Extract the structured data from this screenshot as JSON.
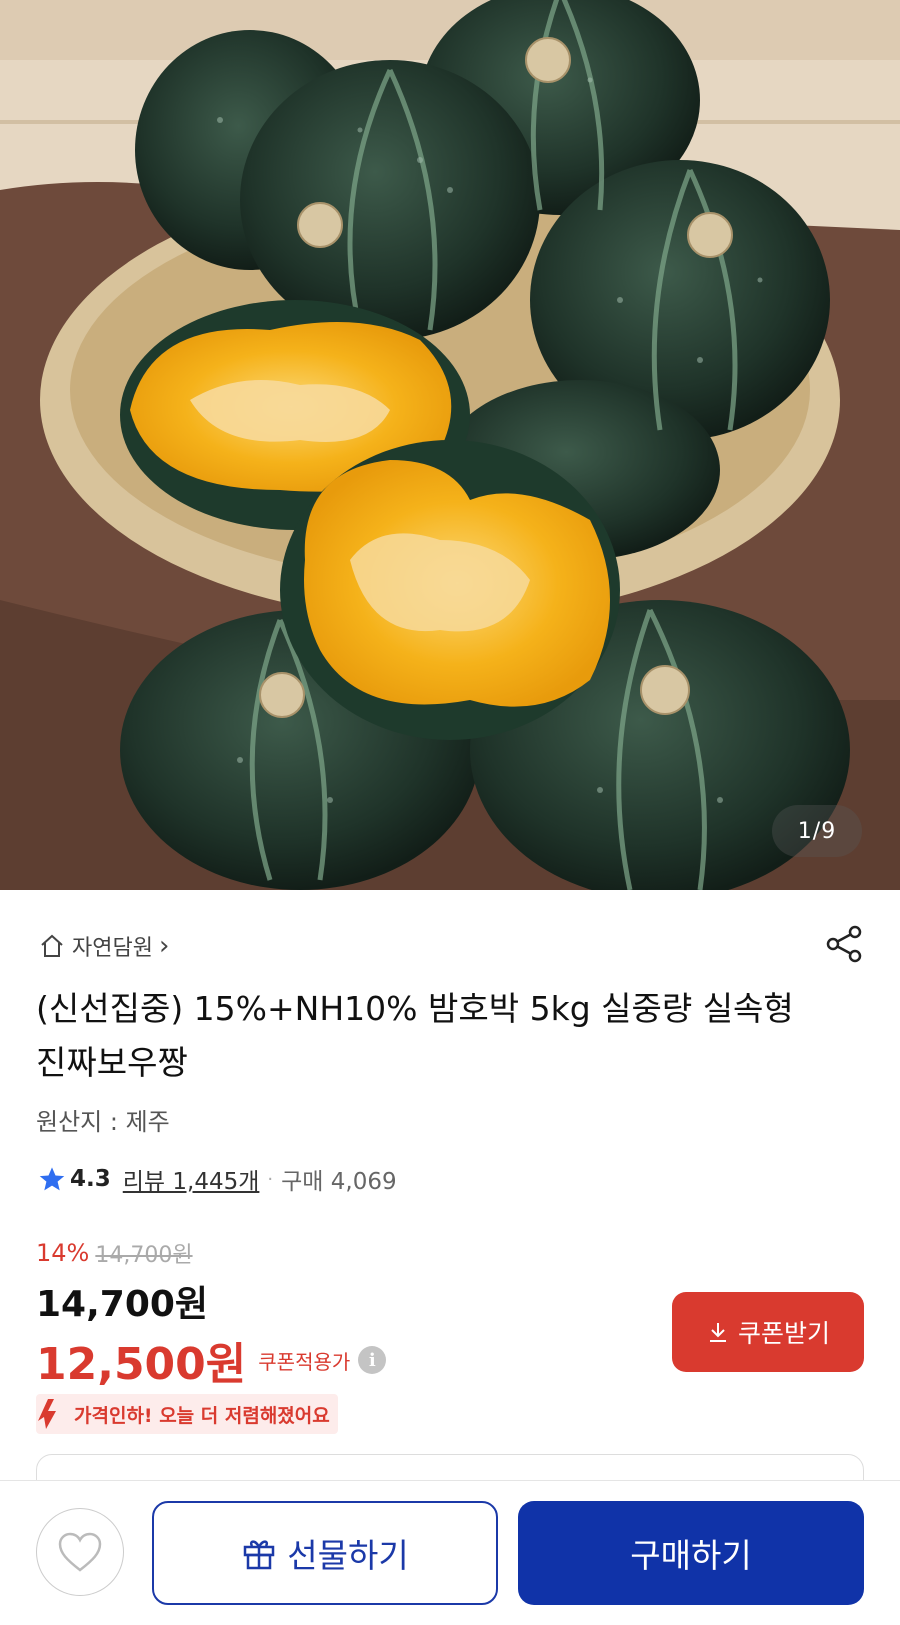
{
  "gallery": {
    "counter": "1/9"
  },
  "seller": {
    "name": "자연담원",
    "chevron": "›"
  },
  "product": {
    "title": "(신선집중) 15%+NH10% 밤호박 5kg 실중량 실속형 진짜보우짱",
    "origin": "원산지 : 제주",
    "rating": "4.3",
    "review_label": "리뷰 1,445개",
    "separator": "·",
    "purchase_label": "구매 4,069"
  },
  "pricing": {
    "discount_rate": "14%",
    "original_price": "14,700원",
    "price": "14,700원",
    "coupon_price": "12,500원",
    "coupon_label": "쿠폰적용가",
    "info_glyph": "i",
    "coupon_button": "쿠폰받기",
    "price_drop_text": "가격인하! 오늘 더 저렴해졌어요"
  },
  "bottom_bar": {
    "gift_label": "선물하기",
    "buy_label": "구매하기"
  },
  "colors": {
    "accent_red": "#d93a2f",
    "primary_blue": "#1033a8"
  },
  "icons": [
    "home-icon",
    "share-icon",
    "star-icon",
    "info-icon",
    "download-arrow-icon",
    "price-down-arrow-icon",
    "heart-icon",
    "gift-icon"
  ]
}
